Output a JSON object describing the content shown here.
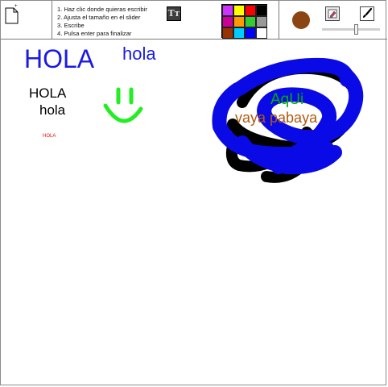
{
  "toolbar": {
    "instructions": [
      "1. Haz clic donde quieras escribir",
      "2. Ajusta el tamaño en el slider",
      "3. Escribe",
      "4. Pulsa enter para finalizar"
    ],
    "text_tool_label": "Tт",
    "palette": [
      "#cc33ff",
      "#ffff00",
      "#ff0000",
      "#000000",
      "#cc0099",
      "#ff9900",
      "#33cc33",
      "#999999",
      "#993300",
      "#00ccff",
      "#0000ff",
      "#ffffff"
    ],
    "selected_color": "#8b4513",
    "icons": {
      "new_document": "new-document-icon",
      "text_tool": "text-tool-icon",
      "eraser": "eraser-icon",
      "brush": "brush-icon"
    }
  },
  "canvas": {
    "texts": [
      {
        "text": "HOLA",
        "color": "#1a1ae6"
      },
      {
        "text": "hola",
        "color": "#1a1ae6"
      },
      {
        "text": "HOLA",
        "color": "#000000"
      },
      {
        "text": "hola",
        "color": "#000000"
      },
      {
        "text": "HOLA",
        "color": "#ff0000"
      },
      {
        "text": "AqUi",
        "color": "#00b000"
      },
      {
        "text": "vaya pabaya",
        "color": "#b05a10"
      }
    ]
  }
}
